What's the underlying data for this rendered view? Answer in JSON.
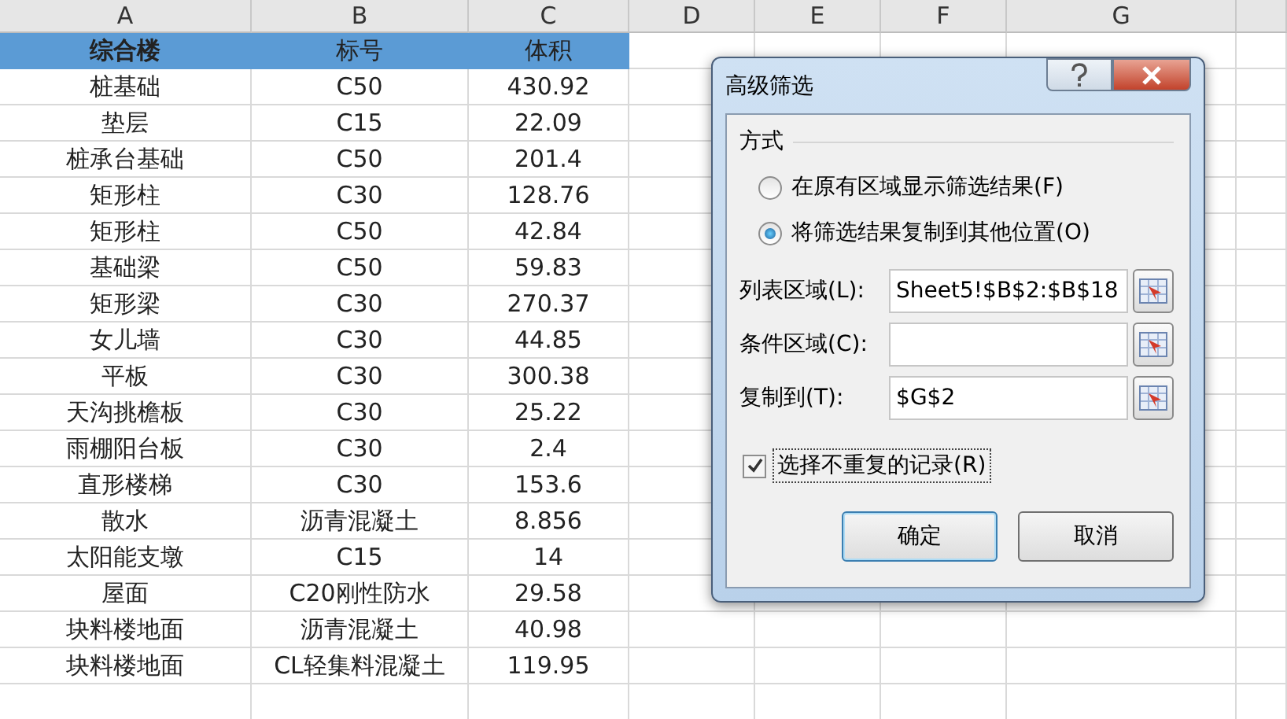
{
  "sheet": {
    "column_headers": [
      "A",
      "B",
      "C",
      "D",
      "E",
      "F",
      "G"
    ],
    "header_row": [
      {
        "text": "综合楼",
        "bold": true
      },
      {
        "text": "标号",
        "bold": false
      },
      {
        "text": "体积",
        "bold": false
      }
    ],
    "rows": [
      [
        "桩基础",
        "C50",
        "430.92"
      ],
      [
        "垫层",
        "C15",
        "22.09"
      ],
      [
        "桩承台基础",
        "C50",
        "201.4"
      ],
      [
        "矩形柱",
        "C30",
        "128.76"
      ],
      [
        "矩形柱",
        "C50",
        "42.84"
      ],
      [
        "基础梁",
        "C50",
        "59.83"
      ],
      [
        "矩形梁",
        "C30",
        "270.37"
      ],
      [
        "女儿墙",
        "C30",
        "44.85"
      ],
      [
        "平板",
        "C30",
        "300.38"
      ],
      [
        "天沟挑檐板",
        "C30",
        "25.22"
      ],
      [
        "雨棚阳台板",
        "C30",
        "2.4"
      ],
      [
        "直形楼梯",
        "C30",
        "153.6"
      ],
      [
        "散水",
        "沥青混凝土",
        "8.856"
      ],
      [
        "太阳能支墩",
        "C15",
        "14"
      ],
      [
        "屋面",
        "C20刚性防水",
        "29.58"
      ],
      [
        "块料楼地面",
        "沥青混凝土",
        "40.98"
      ],
      [
        "块料楼地面",
        "CL轻集料混凝土",
        "119.95"
      ]
    ]
  },
  "dialog": {
    "title": "高级筛选",
    "group_label": "方式",
    "radios": [
      {
        "label": "在原有区域显示筛选结果(F)",
        "selected": false
      },
      {
        "label": "将筛选结果复制到其他位置(O)",
        "selected": true
      }
    ],
    "fields": [
      {
        "label": "列表区域(L):",
        "value": "Sheet5!$B$2:$B$18"
      },
      {
        "label": "条件区域(C):"
      },
      {
        "label": "复制到(T):",
        "value": "$G$2"
      }
    ],
    "checkbox": {
      "label": "选择不重复的记录(R)",
      "checked": true
    },
    "buttons": [
      {
        "label": "确定",
        "default": true
      },
      {
        "label": "取消",
        "default": false
      }
    ]
  }
}
